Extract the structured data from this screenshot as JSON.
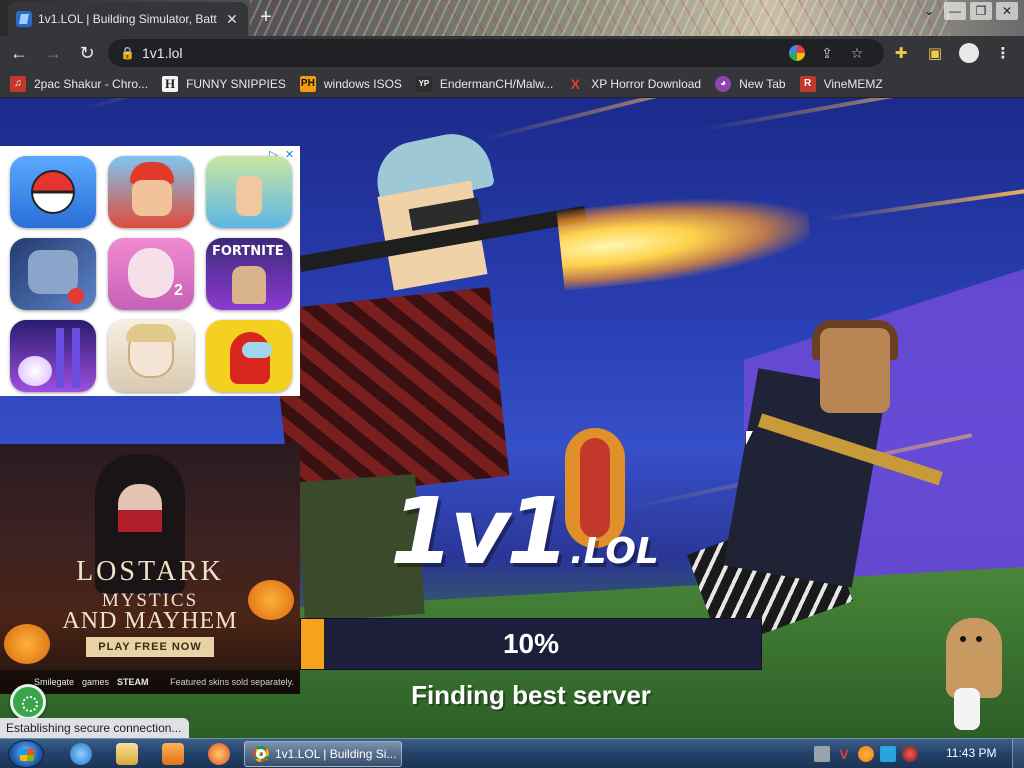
{
  "browser": {
    "tab_title": "1v1.LOL | Building Simulator, Batt",
    "tab_close": "✕",
    "new_tab": "+",
    "url": "1v1.lol",
    "bookmarks": [
      {
        "label": "2pac Shakur - Chro...",
        "icon": "bookmark-favicon-2pac",
        "color": "#c0392b",
        "glyph": "♫"
      },
      {
        "label": "FUNNY SNIPPIES",
        "icon": "bookmark-favicon-h",
        "color": "#202124",
        "glyph": "H"
      },
      {
        "label": "windows ISOS",
        "icon": "bookmark-favicon-ph",
        "color": "#f39c12",
        "glyph": "PH"
      },
      {
        "label": "EndermanCH/Malw...",
        "icon": "bookmark-favicon-yp",
        "color": "#2d2d2d",
        "glyph": "YP"
      },
      {
        "label": "XP Horror Download",
        "icon": "bookmark-favicon-x",
        "color": "#35363a",
        "glyph": "X"
      },
      {
        "label": "New Tab",
        "icon": "bookmark-favicon-newtab",
        "color": "#8e44ad",
        "glyph": "◕"
      },
      {
        "label": "VineMEMZ",
        "icon": "bookmark-favicon-r",
        "color": "#c0392b",
        "glyph": "R"
      }
    ]
  },
  "game": {
    "progress_text": "10%",
    "progress_fraction": 0.05,
    "status_message": "Finding best server",
    "logo_main": "1v1",
    "logo_suffix": ".LOL",
    "colors": {
      "progress_fill": "#f6a21a",
      "progress_track": "#1c1e3a"
    }
  },
  "ads": {
    "app_grid": {
      "adchoices": [
        "▷",
        "✕"
      ],
      "apps": [
        {
          "name": "app-icon-pokemon-go"
        },
        {
          "name": "app-icon-subway-surfers"
        },
        {
          "name": "app-icon-puzzle-game"
        },
        {
          "name": "app-icon-free-fire"
        },
        {
          "name": "app-icon-talking-angela-2"
        },
        {
          "name": "app-icon-fortnite"
        },
        {
          "name": "app-icon-tiles-hop"
        },
        {
          "name": "app-icon-anime-game"
        },
        {
          "name": "app-icon-among-us"
        }
      ],
      "fortnite_text": "FORTNITE",
      "angela_text": "2"
    },
    "lost_ark": {
      "title": "LOSTARK",
      "subtitle_1": "MYSTICS",
      "subtitle_2": "AND MAYHEM",
      "cta": "PLAY FREE NOW",
      "footer_brand_1": "Smilegate",
      "footer_brand_2": "games",
      "footer_brand_3": "STEAM",
      "footer_disclaimer": "Featured skins sold separately."
    }
  },
  "status_bar": "Establishing secure connection...",
  "taskbar": {
    "chrome_window_label": "1v1.LOL | Building Si...",
    "clock": "11:43 PM"
  }
}
